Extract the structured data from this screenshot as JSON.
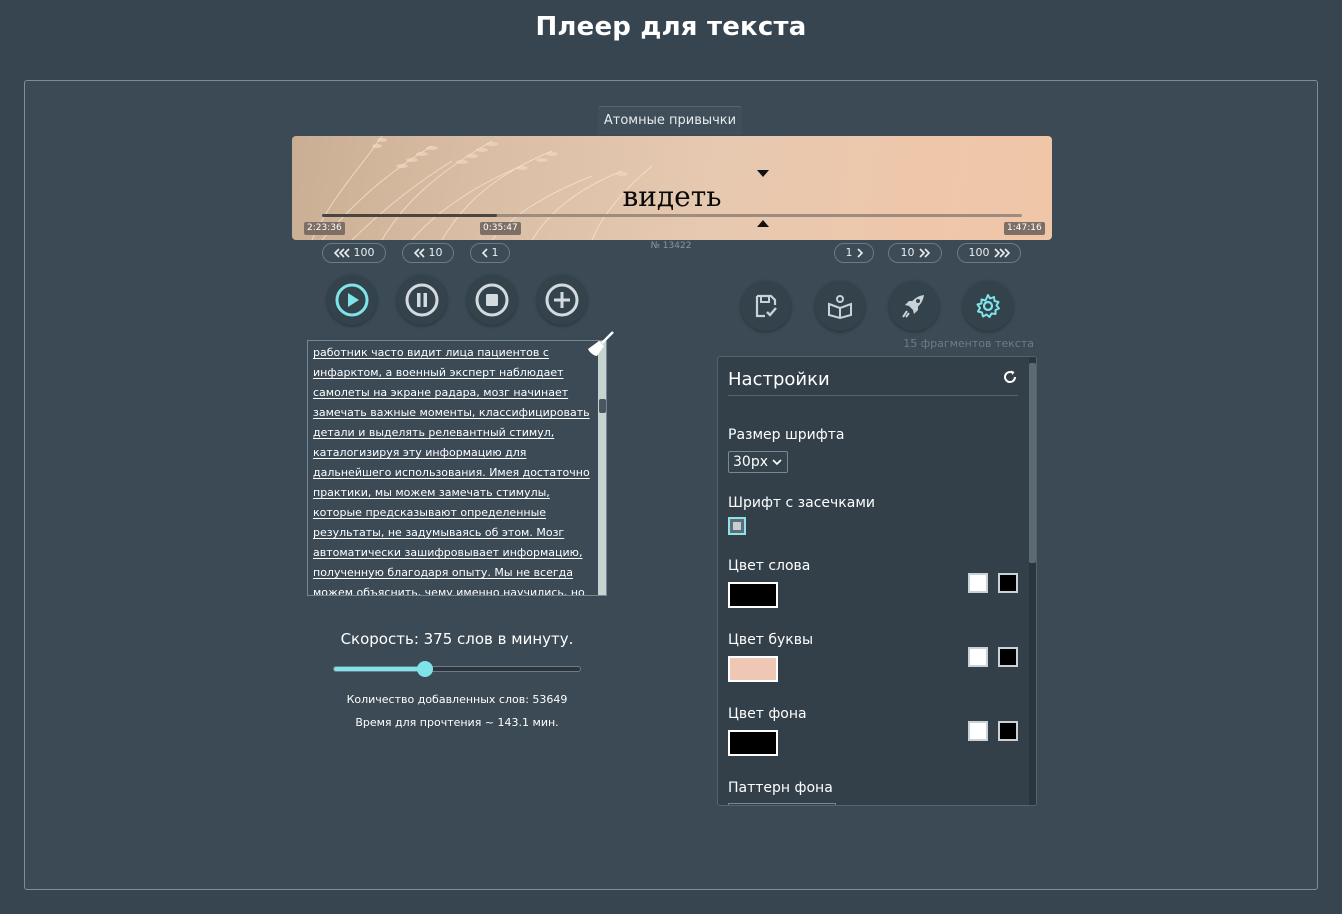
{
  "page_title": "Плеер для текста",
  "book_title": "Атомные привычки",
  "display": {
    "current_word": "видеть",
    "progress_fraction": 0.25,
    "time_total": "2:23:36",
    "time_current": "0:35:47",
    "time_remaining": "1:47:16",
    "fragment_number": "№ 13422",
    "word_color": "#000000",
    "letter_color": "#f0c6b4"
  },
  "skip_back": [
    {
      "label": "100",
      "icon": "triple-chevron-left-icon"
    },
    {
      "label": "10",
      "icon": "double-chevron-left-icon"
    },
    {
      "label": "1",
      "icon": "chevron-left-icon"
    }
  ],
  "skip_forward": [
    {
      "label": "1",
      "icon": "chevron-right-icon"
    },
    {
      "label": "10",
      "icon": "double-chevron-right-icon"
    },
    {
      "label": "100",
      "icon": "triple-chevron-right-icon"
    }
  ],
  "player_controls": [
    "play-icon",
    "pause-icon",
    "stop-icon",
    "add-icon"
  ],
  "tool_buttons": [
    "save-check-icon",
    "open-book-icon",
    "rocket-icon",
    "gear-icon"
  ],
  "text_input": {
    "lines": [
      "работник часто видит лица пациентов с ",
      "инфарктом, а военный эксперт наблюдает ",
      "самолеты на экране радара, мозг начинает ",
      "замечать важные моменты, классифицировать ",
      "детали и выделять релевантный стимул, ",
      "каталогизируя эту информацию для ",
      "дальнейшего использования. Имея достаточно ",
      "практики, мы можем замечать стимулы, ",
      "которые предсказывают определенные ",
      "результаты, не задумываясь об этом. Мозг ",
      "автоматически зашифровывает информацию, ",
      "полученную благодаря опыту. Мы не всегда ",
      "можем объяснить, чему именно научились, но"
    ]
  },
  "speed": {
    "label": "Скорость: 375 слов в минуту.",
    "slider_fraction": 0.37
  },
  "stats": {
    "words_added": "Количество добавленных слов: 53649",
    "read_time": "Время для прочтения ~ 143.1 мин."
  },
  "fragments_count": "15 фрагментов текста",
  "settings": {
    "title": "Настройки",
    "font_size_label": "Размер шрифта",
    "font_size_value": "30px",
    "serif_label": "Шрифт с засечками",
    "word_color_label": "Цвет слова",
    "word_color": "#000000",
    "letter_color_label": "Цвет буквы",
    "letter_color": "#f0c6b4",
    "bg_color_label": "Цвет фона",
    "bg_color": "#000000",
    "bg_pattern_label": "Паттерн фона"
  },
  "colors": {
    "accent": "#7fe4ea",
    "background": "#364550",
    "panel": "#3b4a55"
  }
}
